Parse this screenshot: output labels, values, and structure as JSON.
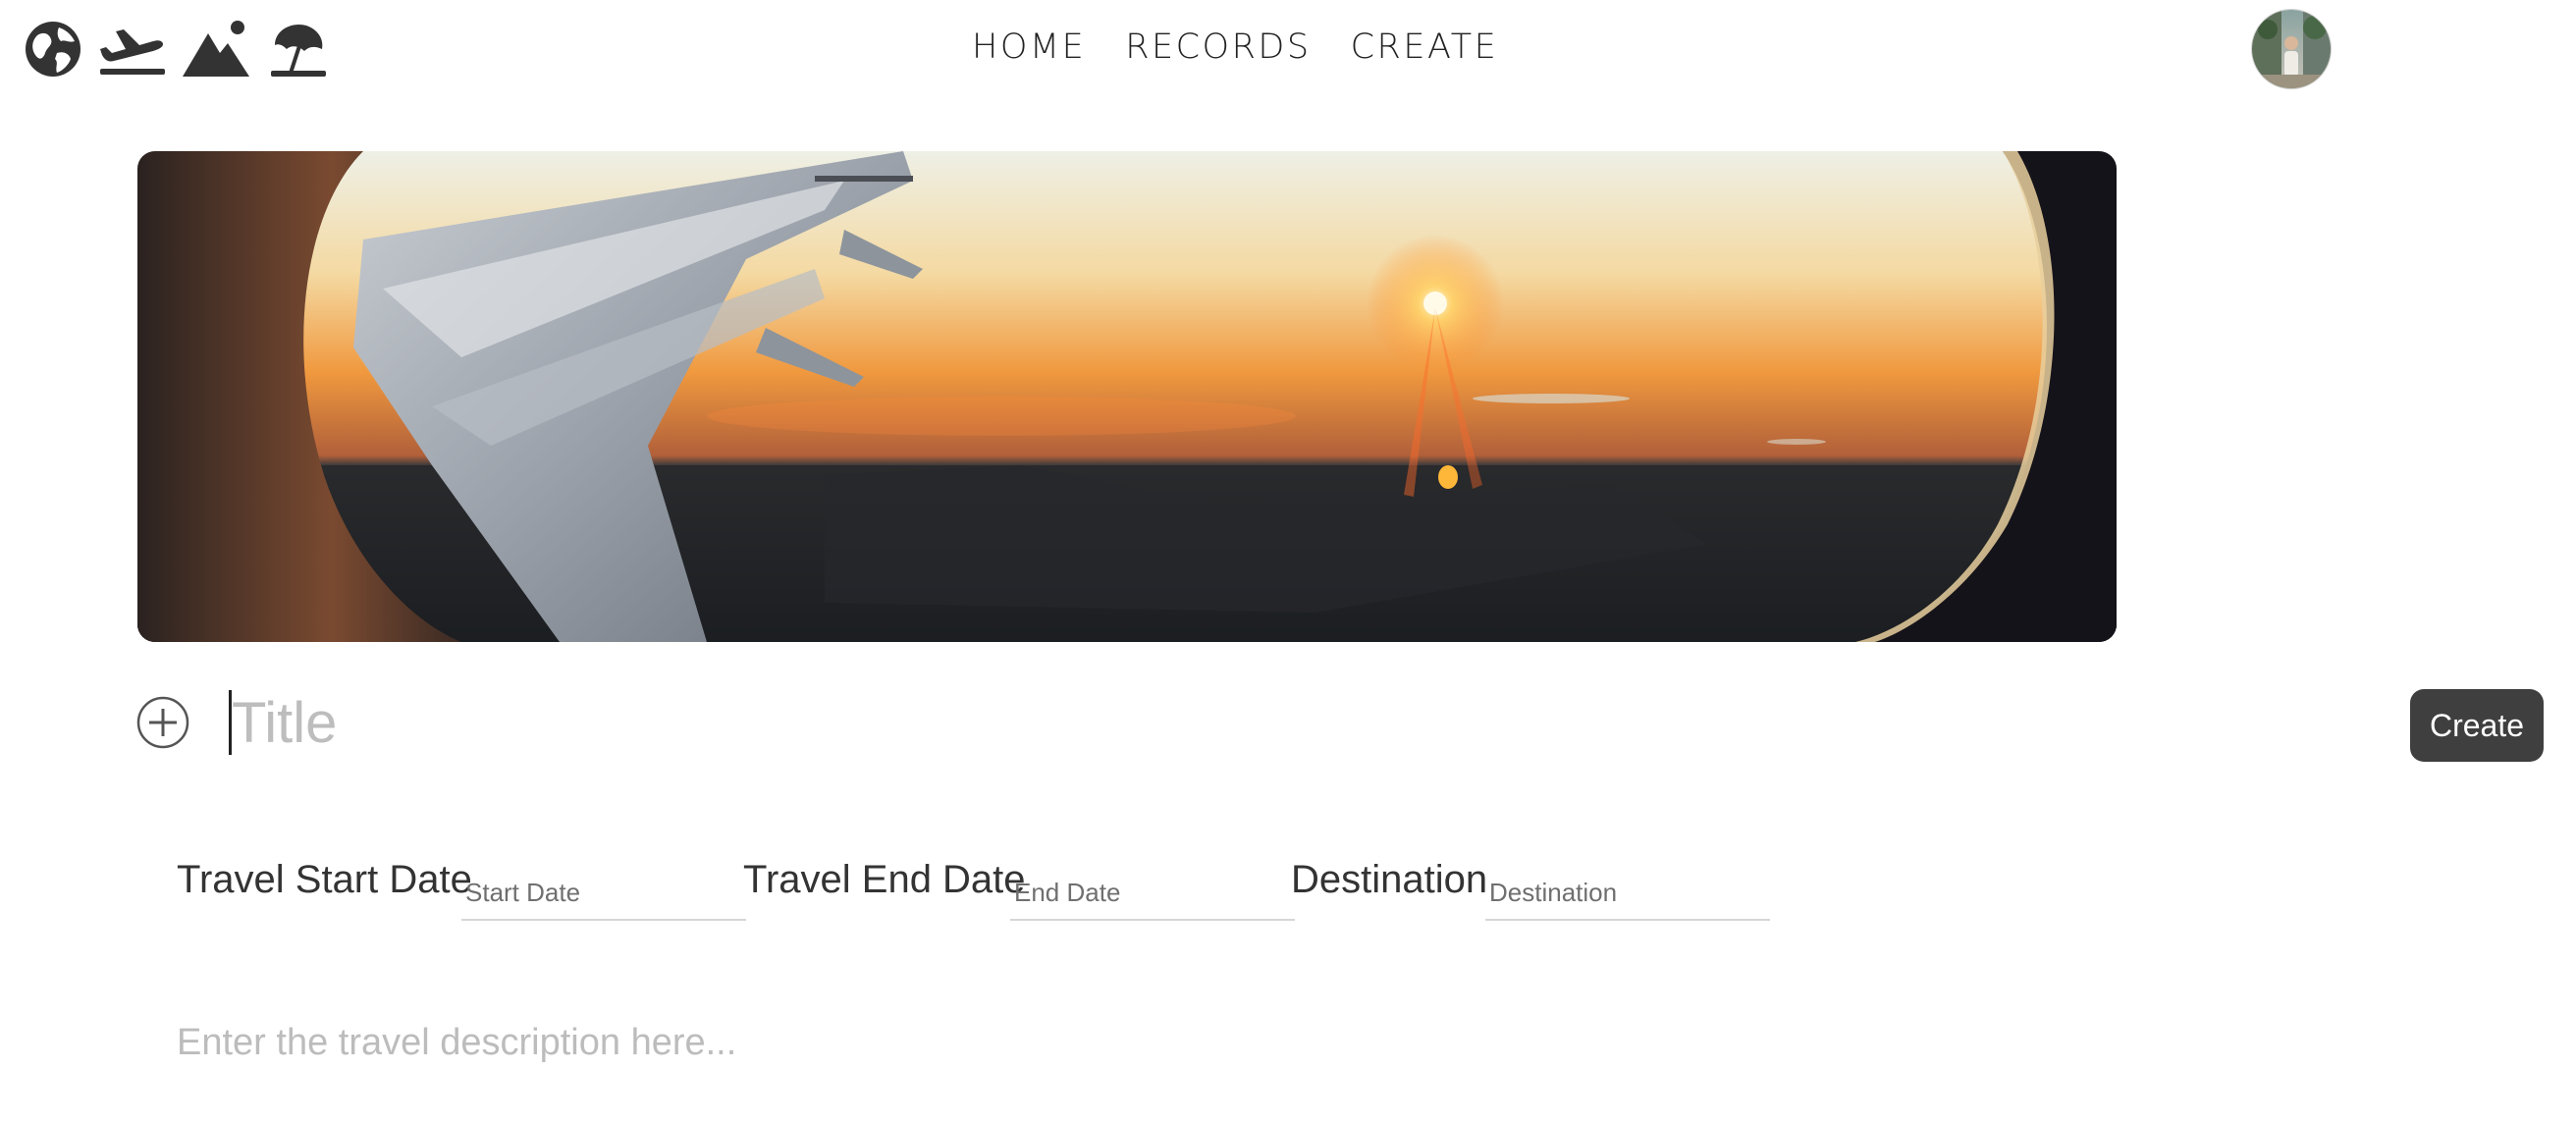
{
  "header": {
    "icons": [
      "globe-icon",
      "airplane-takeoff-icon",
      "mountain-icon",
      "beach-umbrella-icon"
    ],
    "nav": [
      {
        "label": "HOME"
      },
      {
        "label": "RECORDS"
      },
      {
        "label": "CREATE"
      }
    ],
    "avatar_icon": "user-avatar"
  },
  "banner": {
    "image": "airplane-window-sunset"
  },
  "form": {
    "add_icon": "plus-circle-icon",
    "title_placeholder": "Title",
    "create_label": "Create",
    "start_label": "Travel Start Date",
    "start_placeholder": "Start Date",
    "end_label": "Travel End Date",
    "end_placeholder": "End Date",
    "destination_label": "Destination",
    "destination_placeholder": "Destination",
    "description_placeholder": "Enter the travel description here..."
  },
  "colors": {
    "icon": "#333333",
    "button_bg": "#3f3f3f",
    "placeholder": "#bdbdbd",
    "underline": "#d6d6d6"
  }
}
